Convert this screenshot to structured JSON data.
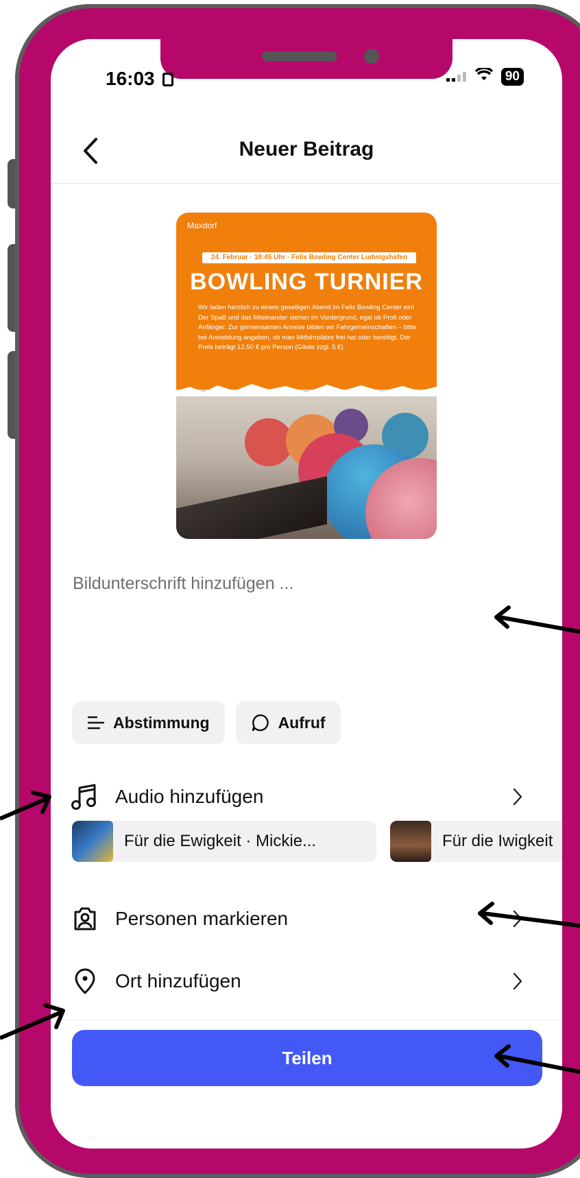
{
  "status": {
    "time": "16:03",
    "battery": "90"
  },
  "header": {
    "title": "Neuer Beitrag"
  },
  "poster": {
    "logo": "Maxdorf",
    "banner": "24. Februar · 18:45 Uhr · Felix Bowling Center Ludwigshafen",
    "title": "BOWLING TURNIER",
    "text": "Wir laden herzlich zu einem geselligen Abend im Felix Bowling Center ein! Der Spaß und das Miteinander stehen im Vordergrund, egal ob Profi oder Anfänger. Zur gemeinsamen Anreise bilden wir Fahrgemeinschaften – bitte bei Anmeldung angeben, ob man Mitfahrplätze frei hat oder benötigt. Der Preis beträgt 12,50 € pro Person (Gäste zzgl. 5 €)."
  },
  "caption": {
    "placeholder": "Bildunterschrift hinzufügen ..."
  },
  "chips": [
    {
      "label": "Abstimmung"
    },
    {
      "label": "Aufruf"
    }
  ],
  "rows": {
    "audio": "Audio hinzufügen",
    "people": "Personen markieren",
    "location": "Ort hinzufügen"
  },
  "suggestions": [
    {
      "label": "Für die Ewigkeit · Mickie..."
    },
    {
      "label": "Für die Iwigkeit"
    }
  ],
  "share": {
    "label": "Teilen"
  },
  "colors": {
    "frame": "#b5086a",
    "primary": "#4358f4"
  }
}
